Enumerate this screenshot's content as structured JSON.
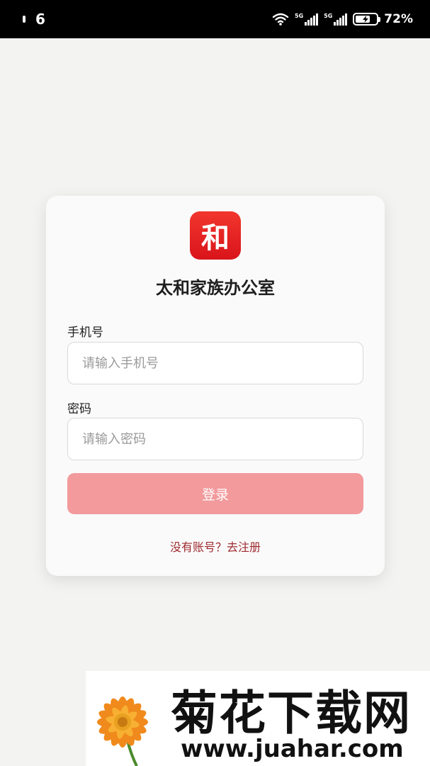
{
  "status_bar": {
    "time": "6",
    "sim1_label": "5G",
    "sim2_label": "5G",
    "battery_percent": "72%",
    "battery_level": 0.72
  },
  "login": {
    "logo_char": "和",
    "app_title": "太和家族办公室",
    "phone_label": "手机号",
    "phone_placeholder": "请输入手机号",
    "phone_value": "",
    "password_label": "密码",
    "password_placeholder": "请输入密码",
    "password_value": "",
    "login_button": "登录",
    "register_link": "没有账号？去注册"
  },
  "watermark": {
    "title": "菊花下载网",
    "url": "www.juahar.com"
  },
  "colors": {
    "logo_red": "#e3211f",
    "button_pink": "#f29a9c",
    "link_red": "#9e2a2f",
    "background": "#f3f3f1"
  }
}
